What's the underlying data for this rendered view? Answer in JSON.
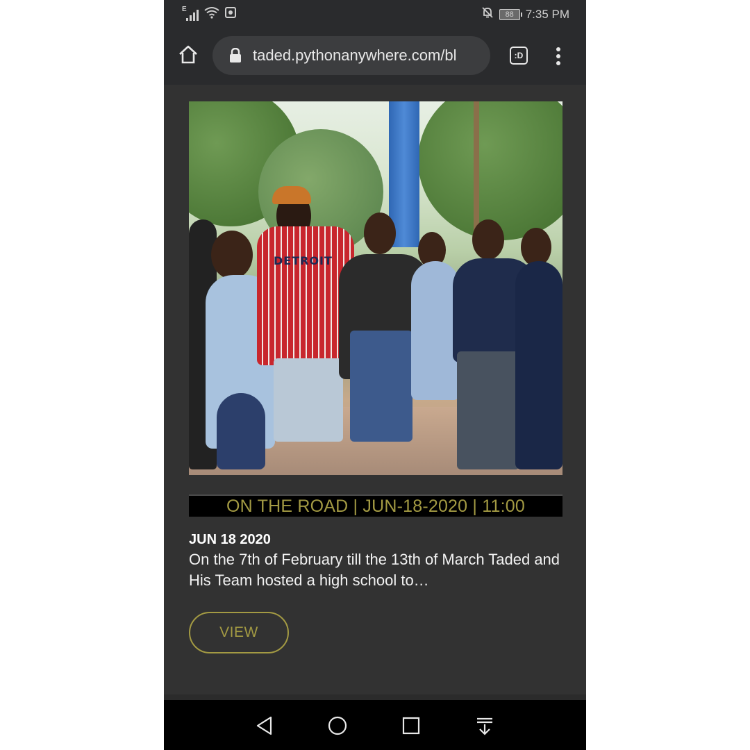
{
  "status_bar": {
    "signal_label": "E",
    "battery_level": "88",
    "time": "7:35 PM",
    "icons": [
      "signal-icon",
      "wifi-icon",
      "notification-app-icon",
      "mute-icon",
      "battery-icon"
    ]
  },
  "browser": {
    "url": "taded.pythonanywhere.com/bl",
    "icons": [
      "home-icon",
      "lock-icon",
      "tab-switcher-icon",
      "overflow-menu-icon"
    ],
    "tab_badge": ":D"
  },
  "post": {
    "caption": "ON THE ROAD | JUN-18-2020 | 11:00",
    "date": "JUN 18 2020",
    "excerpt": "On the 7th of February till the 13th of March Taded and His Team hosted a high school to…",
    "view_label": "VIEW",
    "image_jersey_text": "DETROIT"
  },
  "nav_bar": {
    "icons": [
      "back-icon",
      "home-circle-icon",
      "recents-icon",
      "notification-pull-icon"
    ]
  },
  "colors": {
    "accent_gold": "#a39a43",
    "background": "#323232",
    "toolbar": "#2a2b2d",
    "caption_bar": "#000000"
  }
}
